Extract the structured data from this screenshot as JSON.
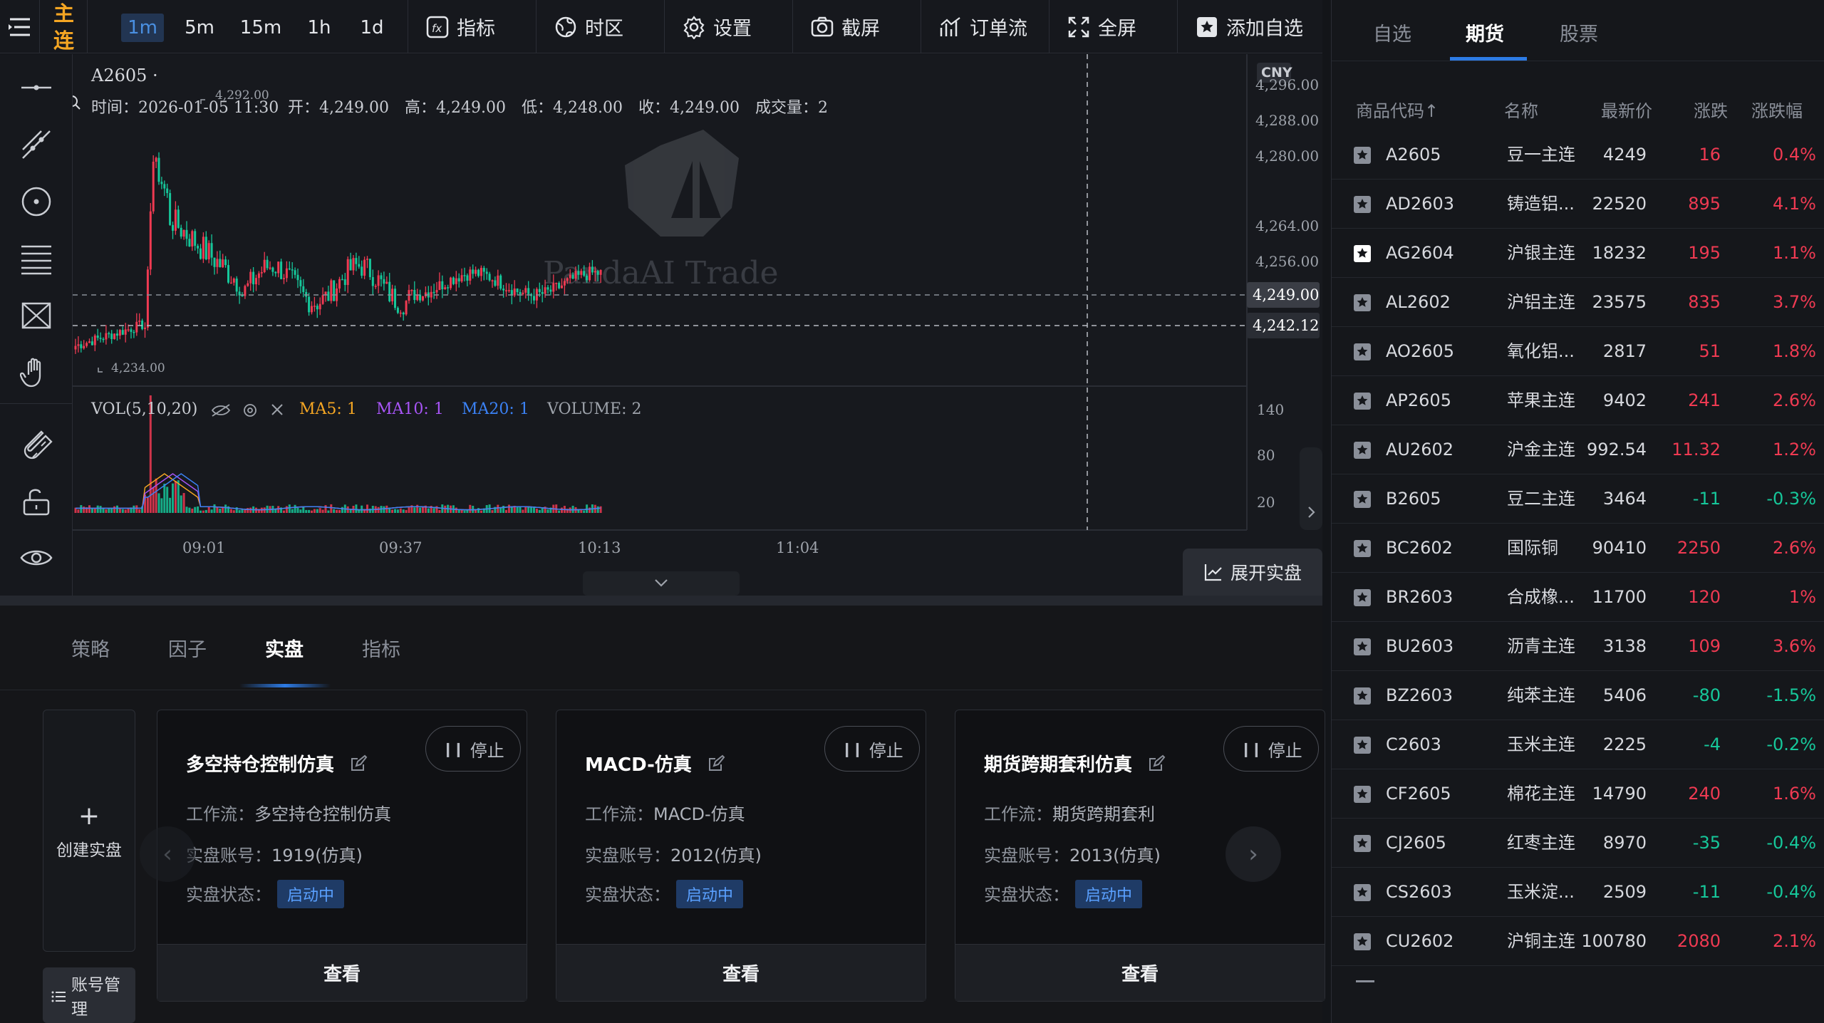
{
  "topbar": {
    "symbol_line1": "主",
    "symbol_line2": "连",
    "timeframes": [
      "1m",
      "5m",
      "15m",
      "1h",
      "1d"
    ],
    "tools": {
      "indicator": "指标",
      "timezone": "时区",
      "settings": "设置",
      "screenshot": "截屏",
      "orderflow": "订单流",
      "fullscreen": "全屏",
      "watchlist_add": "添加自选"
    }
  },
  "chart": {
    "symbol": "A2605 ·",
    "currency": "CNY",
    "ohlc": {
      "time": "时间：2026-01-05 11:30",
      "open": "开：4,249.00",
      "high": "高：4,249.00",
      "low": "低：4,248.00",
      "close": "收：4,249.00",
      "volume": "成交量：2"
    },
    "price_ticks": [
      "4,296.00",
      "4,288.00",
      "4,280.00",
      "4,264.00",
      "4,256.00"
    ],
    "price_tags": {
      "current": "4,249.00",
      "crosshair": "4,242.12"
    },
    "high_label": "4,292.00",
    "low_label": "4,234.00",
    "volume_legend": {
      "title": "VOL(5,10,20)",
      "ma5": "MA5: 1",
      "ma10": "MA10: 1",
      "ma20": "MA20: 1",
      "volume": "VOLUME: 2"
    },
    "volume_ticks": [
      "140",
      "80",
      "20"
    ],
    "time_ticks": [
      "09:01",
      "09:37",
      "10:13",
      "11:04"
    ],
    "watermark": "PandaAI Trade",
    "expand_button": "展开实盘",
    "colors": {
      "up": "#ef3a52",
      "down": "#16c79a",
      "ma5": "#f5a623",
      "ma10": "#a855f7",
      "ma20": "#3b82f6"
    }
  },
  "bottom": {
    "tabs": [
      "策略",
      "因子",
      "实盘",
      "指标"
    ],
    "active_tab": "实盘",
    "create_label": "创建实盘",
    "account_label_1": "账号管",
    "account_label_2": "理",
    "cards": [
      {
        "title": "多空持仓控制仿真",
        "stop": "停止",
        "workflow_label": "工作流：",
        "workflow": "多空持仓控制仿真",
        "account_label": "实盘账号：",
        "account": "1919(仿真)",
        "status_label": "实盘状态：",
        "status": "启动中",
        "view": "查看"
      },
      {
        "title": "MACD-仿真",
        "stop": "停止",
        "workflow_label": "工作流：",
        "workflow": "MACD-仿真",
        "account_label": "实盘账号：",
        "account": "2012(仿真)",
        "status_label": "实盘状态：",
        "status": "启动中",
        "view": "查看"
      },
      {
        "title": "期货跨期套利仿真",
        "stop": "停止",
        "workflow_label": "工作流：",
        "workflow": "期货跨期套利",
        "account_label": "实盘账号：",
        "account": "2013(仿真)",
        "status_label": "实盘状态：",
        "status": "启动中",
        "view": "查看"
      }
    ]
  },
  "watchlist": {
    "tabs": [
      "自选",
      "期货",
      "股票"
    ],
    "active_tab": "期货",
    "headers": {
      "code": "商品代码↑",
      "name": "名称",
      "last": "最新价",
      "change": "涨跌",
      "pct": "涨跌幅"
    },
    "rows": [
      {
        "code": "A2605",
        "name": "豆一主连",
        "last": "4249",
        "change": "16",
        "pct": "0.4%",
        "dir": "up",
        "starred": false
      },
      {
        "code": "AD2603",
        "name": "铸造铝...",
        "last": "22520",
        "change": "895",
        "pct": "4.1%",
        "dir": "up",
        "starred": false
      },
      {
        "code": "AG2604",
        "name": "沪银主连",
        "last": "18232",
        "change": "195",
        "pct": "1.1%",
        "dir": "up",
        "starred": true
      },
      {
        "code": "AL2602",
        "name": "沪铝主连",
        "last": "23575",
        "change": "835",
        "pct": "3.7%",
        "dir": "up",
        "starred": false
      },
      {
        "code": "AO2605",
        "name": "氧化铝...",
        "last": "2817",
        "change": "51",
        "pct": "1.8%",
        "dir": "up",
        "starred": false
      },
      {
        "code": "AP2605",
        "name": "苹果主连",
        "last": "9402",
        "change": "241",
        "pct": "2.6%",
        "dir": "up",
        "starred": false
      },
      {
        "code": "AU2602",
        "name": "沪金主连",
        "last": "992.54",
        "change": "11.32",
        "pct": "1.2%",
        "dir": "up",
        "starred": false
      },
      {
        "code": "B2605",
        "name": "豆二主连",
        "last": "3464",
        "change": "-11",
        "pct": "-0.3%",
        "dir": "dn",
        "starred": false
      },
      {
        "code": "BC2602",
        "name": "国际铜",
        "last": "90410",
        "change": "2250",
        "pct": "2.6%",
        "dir": "up",
        "starred": false
      },
      {
        "code": "BR2603",
        "name": "合成橡...",
        "last": "11700",
        "change": "120",
        "pct": "1%",
        "dir": "up",
        "starred": false
      },
      {
        "code": "BU2603",
        "name": "沥青主连",
        "last": "3138",
        "change": "109",
        "pct": "3.6%",
        "dir": "up",
        "starred": false
      },
      {
        "code": "BZ2603",
        "name": "纯苯主连",
        "last": "5406",
        "change": "-80",
        "pct": "-1.5%",
        "dir": "dn",
        "starred": false
      },
      {
        "code": "C2603",
        "name": "玉米主连",
        "last": "2225",
        "change": "-4",
        "pct": "-0.2%",
        "dir": "dn",
        "starred": false
      },
      {
        "code": "CF2605",
        "name": "棉花主连",
        "last": "14790",
        "change": "240",
        "pct": "1.6%",
        "dir": "up",
        "starred": false
      },
      {
        "code": "CJ2605",
        "name": "红枣主连",
        "last": "8970",
        "change": "-35",
        "pct": "-0.4%",
        "dir": "dn",
        "starred": false
      },
      {
        "code": "CS2603",
        "name": "玉米淀...",
        "last": "2509",
        "change": "-11",
        "pct": "-0.4%",
        "dir": "dn",
        "starred": false
      },
      {
        "code": "CU2602",
        "name": "沪铜主连",
        "last": "100780",
        "change": "2080",
        "pct": "2.1%",
        "dir": "up",
        "starred": false
      }
    ]
  }
}
